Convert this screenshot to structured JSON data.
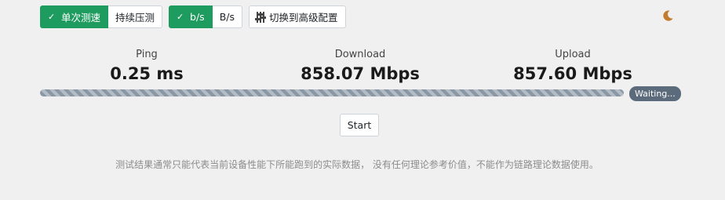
{
  "toolbar": {
    "mode_single": "单次测速",
    "mode_continuous": "持续压测",
    "unit_bits": "b/s",
    "unit_bytes": "B/s",
    "advanced": "切换到高级配置",
    "active_mode": "单次测速",
    "active_unit": "b/s"
  },
  "metrics": {
    "ping": {
      "label": "Ping",
      "value": "0.25 ms"
    },
    "download": {
      "label": "Download",
      "value": "858.07 Mbps"
    },
    "upload": {
      "label": "Upload",
      "value": "857.60 Mbps"
    }
  },
  "progress": {
    "fraction": 1.0,
    "status": "Waiting..."
  },
  "start_label": "Start",
  "note": "测试结果通常只能代表当前设备性能下所能跑到的实际数据， 没有任何理论参考价值，不能作为链路理论数据使用。",
  "colors": {
    "accent": "#1e9b5e",
    "moon": "#c27c2e",
    "badge": "#5b6b7b",
    "progress": "#8a97a5"
  },
  "icons": {
    "check": "check-icon",
    "sliders": "sliders-icon",
    "theme": "moon-icon"
  }
}
